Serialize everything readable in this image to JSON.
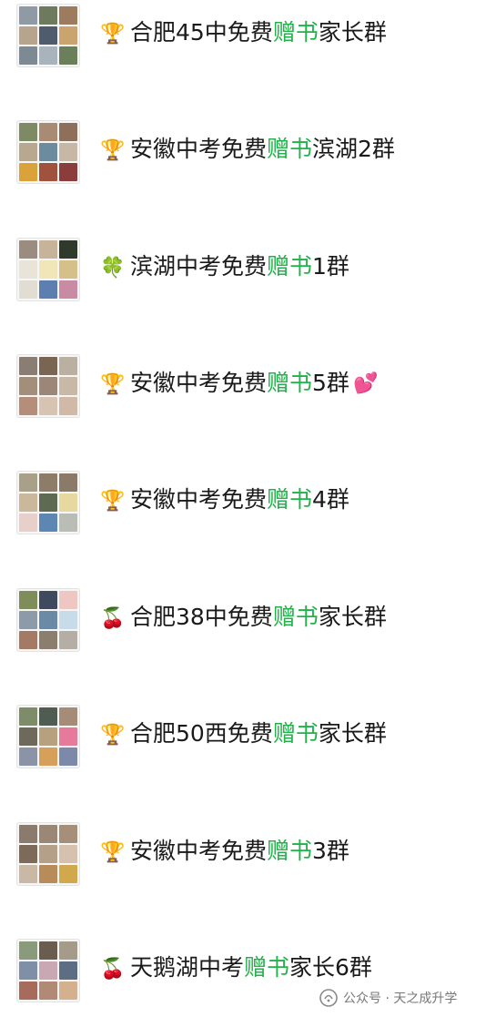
{
  "groups": [
    {
      "emoji": "🏆",
      "prefix": "合肥45中免费",
      "highlight": "赠书",
      "suffix": "家长群",
      "heart": "",
      "tiles": [
        "#8f9aa4",
        "#6d7a5e",
        "#9c7b5e",
        "#b7a48f",
        "#4f5c6d",
        "#c9a46e",
        "#7e8a93",
        "#a9b3bb",
        "#6b7f5a"
      ]
    },
    {
      "emoji": "🏆",
      "prefix": "安徽中考免费",
      "highlight": "赠书",
      "suffix": "滨湖2群",
      "heart": "",
      "tiles": [
        "#7d8a63",
        "#a88b72",
        "#8d6f5a",
        "#b8a890",
        "#6d8b9e",
        "#c7b8a5",
        "#d9a33a",
        "#a0523f",
        "#8a3d3a"
      ]
    },
    {
      "emoji": "🍀",
      "prefix": "滨湖中考免费",
      "highlight": "赠书",
      "suffix": "1群",
      "heart": "",
      "tiles": [
        "#9a8c7e",
        "#c6b39a",
        "#2f3a2c",
        "#e9e4d8",
        "#f1e6b8",
        "#d6c08a",
        "#e2ddd2",
        "#5d7fb0",
        "#c98aa4"
      ]
    },
    {
      "emoji": "🏆",
      "prefix": "安徽中考免费",
      "highlight": "赠书",
      "suffix": "5群",
      "heart": "💕",
      "tiles": [
        "#8a7d72",
        "#7a6552",
        "#b9b0a2",
        "#a38e7a",
        "#9b8677",
        "#c8b9a7",
        "#b48e78",
        "#d7c3b2",
        "#d1b9a8"
      ]
    },
    {
      "emoji": "🏆",
      "prefix": "安徽中考免费",
      "highlight": "赠书",
      "suffix": "4群",
      "heart": "",
      "tiles": [
        "#a9a08a",
        "#8c7c68",
        "#8b7a68",
        "#cbb79a",
        "#5f6a52",
        "#e6d9a0",
        "#e8cfc9",
        "#5e86b3",
        "#b9bdb5"
      ]
    },
    {
      "emoji": "🍒",
      "prefix": "合肥38中免费",
      "highlight": "赠书",
      "suffix": "家长群",
      "heart": "",
      "tiles": [
        "#7e8d5a",
        "#3f4a5e",
        "#efc7c2",
        "#8d9ba8",
        "#6b8aa6",
        "#c8dbe8",
        "#a47a64",
        "#8c7e6e",
        "#b5aea4"
      ]
    },
    {
      "emoji": "🏆",
      "prefix": "合肥50西免费",
      "highlight": "赠书",
      "suffix": "家长群",
      "heart": "",
      "tiles": [
        "#7f8c6a",
        "#4f5c52",
        "#a48c76",
        "#6d6a5c",
        "#b7a07e",
        "#e57a9a",
        "#8b94a6",
        "#d7a05a",
        "#7d89a8"
      ]
    },
    {
      "emoji": "🏆",
      "prefix": "安徽中考免费",
      "highlight": "赠书",
      "suffix": "3群",
      "heart": "",
      "tiles": [
        "#8b7b6c",
        "#9a8776",
        "#a68f78",
        "#7d6a58",
        "#b49f88",
        "#d6c1ae",
        "#c9b8a6",
        "#b88c5a",
        "#d1a84c"
      ]
    },
    {
      "emoji": "🍒",
      "prefix": "天鹅湖中考",
      "highlight": "赠书",
      "suffix": "家长6群",
      "heart": "",
      "tiles": [
        "#8a9b7c",
        "#6a5c4e",
        "#a69b88",
        "#7e8fa6",
        "#c9a8b4",
        "#5d6d84",
        "#a76b5c",
        "#b18a76",
        "#d4b18e"
      ]
    }
  ],
  "watermark": {
    "text": "公众号 · 天之成升学"
  }
}
